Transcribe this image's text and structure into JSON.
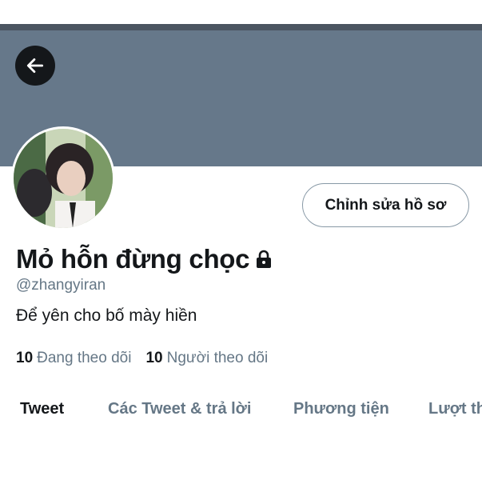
{
  "profile": {
    "display_name": "Mỏ hỗn đừng chọc",
    "handle": "@zhangyiran",
    "bio": "Để yên cho bố mày hiền",
    "following_count": "10",
    "following_label": "Đang theo dõi",
    "followers_count": "10",
    "followers_label": "Người theo dõi"
  },
  "actions": {
    "edit_profile_label": "Chỉnh sửa hồ sơ"
  },
  "tabs": [
    {
      "label": "Tweet",
      "active": true
    },
    {
      "label": "Các Tweet & trả lời",
      "active": false
    },
    {
      "label": "Phương tiện",
      "active": false
    },
    {
      "label": "Lượt th",
      "active": false
    }
  ],
  "icons": {
    "back": "arrow-left-icon",
    "lock": "lock-icon"
  },
  "colors": {
    "banner": "#66788a",
    "header_band": "#4b5561",
    "text_primary": "#14171a",
    "text_secondary": "#657786",
    "button_border": "#8899a6"
  }
}
